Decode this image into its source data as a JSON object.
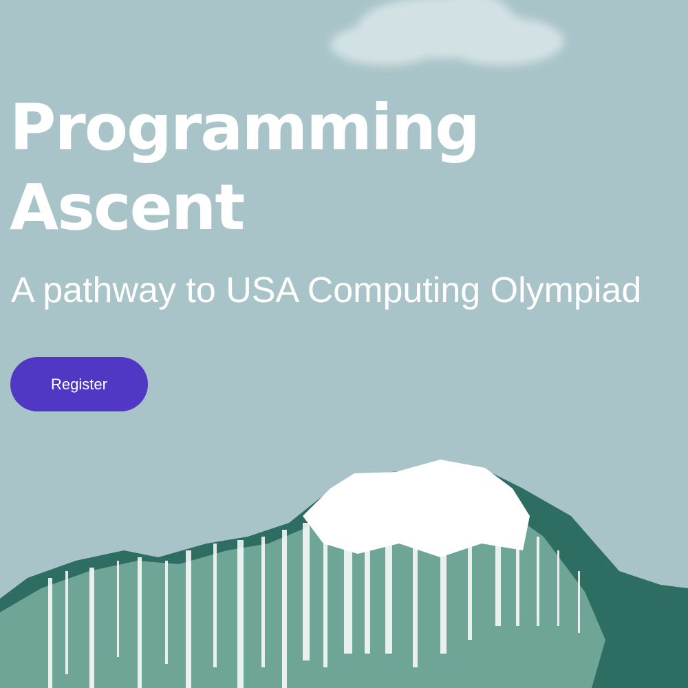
{
  "hero": {
    "title_line1": "Programming",
    "title_line2": "Ascent",
    "subtitle": "A pathway to USA Computing Olympiad",
    "register_label": "Register"
  },
  "colors": {
    "background": "#a9c4c8",
    "button": "#5038c4",
    "text": "#ffffff",
    "mountain_dark": "#2e6e62",
    "mountain_mid": "#6fa596",
    "snow": "#ffffff"
  },
  "illustrations": {
    "cloud": "cloud-illustration",
    "mountain": "snowy-mountain-illustration"
  }
}
